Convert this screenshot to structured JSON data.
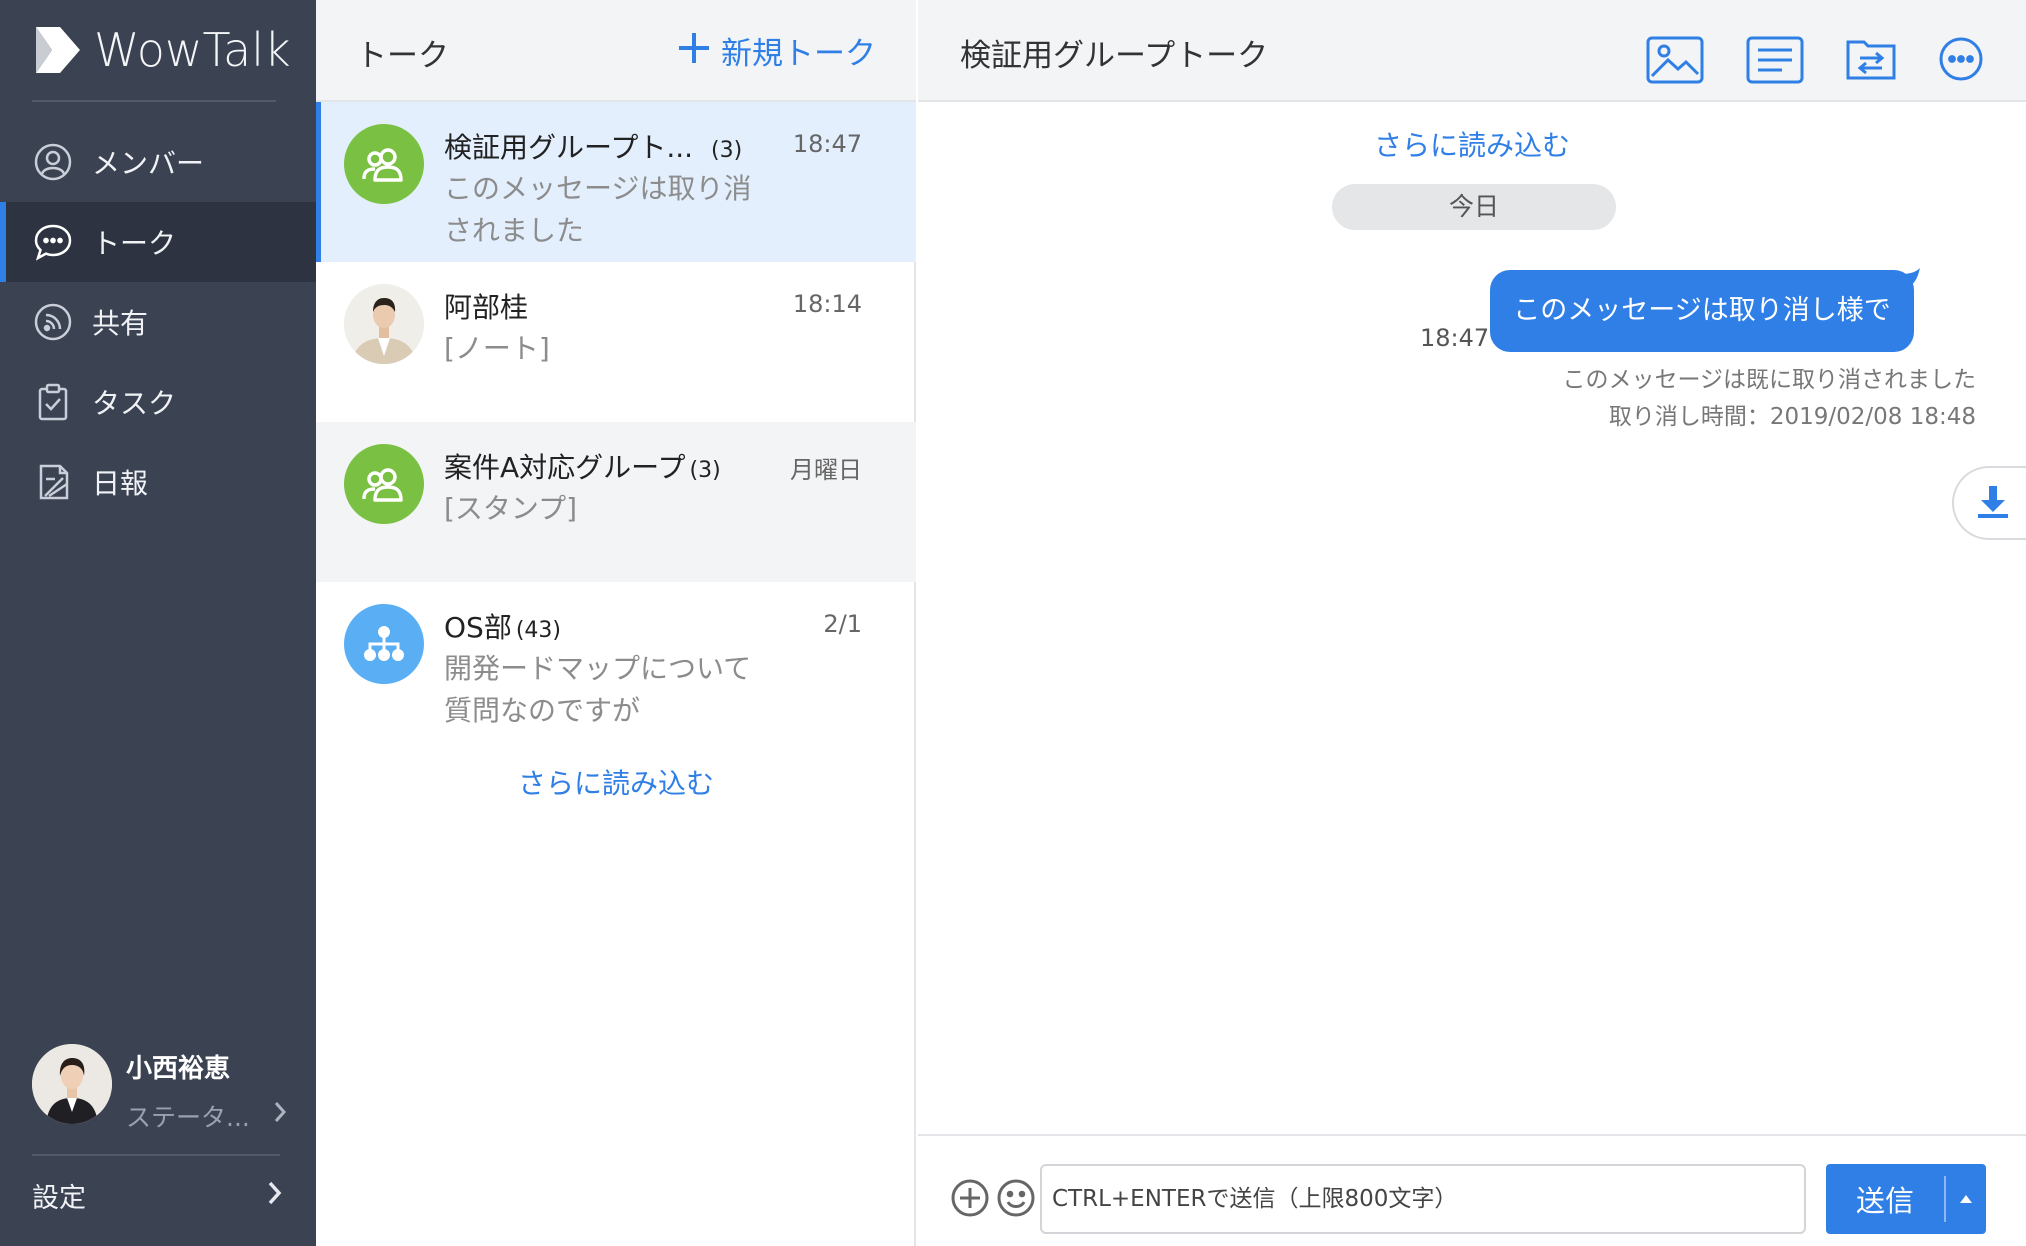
{
  "app": {
    "name": "WowTalk"
  },
  "sidebar": {
    "items": [
      {
        "label": "メンバー",
        "icon": "member-icon",
        "active": false
      },
      {
        "label": "トーク",
        "icon": "talk-icon",
        "active": true
      },
      {
        "label": "共有",
        "icon": "share-icon",
        "active": false
      },
      {
        "label": "タスク",
        "icon": "task-icon",
        "active": false
      },
      {
        "label": "日報",
        "icon": "daily-report-icon",
        "active": false
      }
    ],
    "profile": {
      "name": "小西裕恵",
      "status": "ステータ..."
    },
    "settings_label": "設定"
  },
  "talk_list": {
    "title": "トーク",
    "new_talk_label": "新規トーク",
    "items": [
      {
        "name": "検証用グループト...",
        "count": "(3)",
        "time": "18:47",
        "preview": "このメッセージは取り消されました",
        "avatar": "group-icon",
        "selected": true
      },
      {
        "name": "阿部桂",
        "count": "",
        "time": "18:14",
        "preview": "[ノート]",
        "avatar": "user-photo",
        "selected": false
      },
      {
        "name": "案件A対応グループ",
        "count": "(3)",
        "time": "月曜日",
        "preview": "[スタンプ]",
        "avatar": "group-icon",
        "selected": false
      },
      {
        "name": "OS部",
        "count": "(43)",
        "time": "2/1",
        "preview": "開発ードマップについて質問なのですが",
        "avatar": "org-chart-icon",
        "selected": false
      }
    ],
    "load_more": "さらに読み込む"
  },
  "chat": {
    "title": "検証用グループトーク",
    "header_icons": [
      "image-icon",
      "notes-icon",
      "file-transfer-icon",
      "more-icon"
    ],
    "load_more": "さらに読み込む",
    "date_divider": "今日",
    "message": {
      "text": "このメッセージは取り消し様です。",
      "time": "18:47",
      "recall_notice": "このメッセージは既に取り消されました",
      "recall_time": "取り消し時間：2019/02/08 18:48"
    },
    "composer": {
      "placeholder": "CTRL+ENTERで送信（上限800文字）",
      "send_label": "送信"
    }
  },
  "colors": {
    "accent": "#2f7fe6",
    "sidebar_bg": "#3b4252",
    "group_avatar": "#7ac042",
    "org_avatar": "#5aaef3"
  }
}
